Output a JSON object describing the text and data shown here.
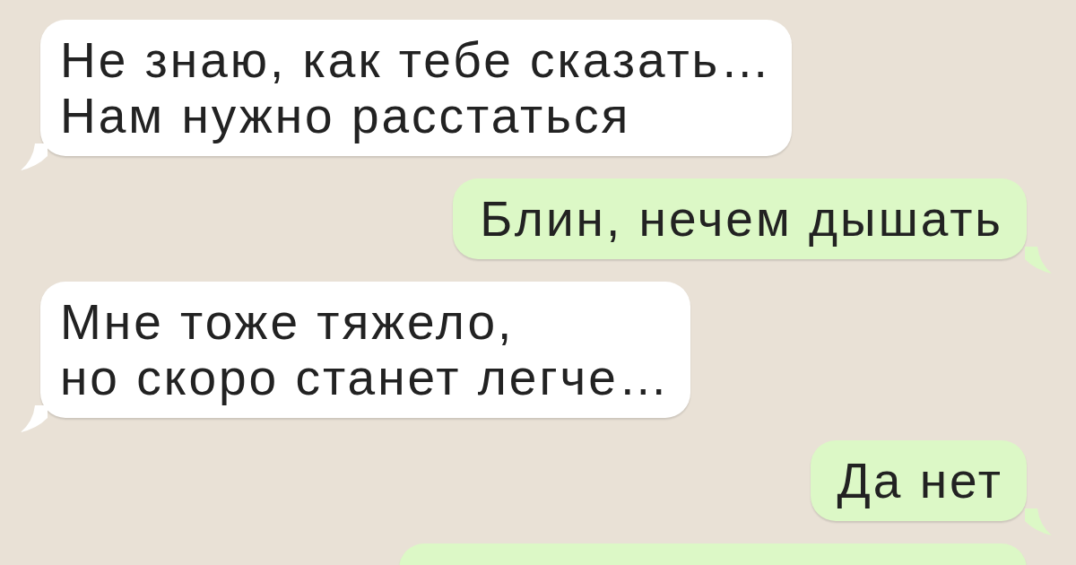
{
  "messages": [
    {
      "kind": "incoming",
      "lines": [
        "Не знаю, как тебе сказать…",
        "Нам нужно расстаться"
      ]
    },
    {
      "kind": "outgoing",
      "lines": [
        "Блин, нечем дышать"
      ]
    },
    {
      "kind": "incoming",
      "lines": [
        "Мне тоже тяжело,",
        "но скоро станет легче…"
      ]
    },
    {
      "kind": "outgoing",
      "lines": [
        "Да нет"
      ]
    },
    {
      "kind": "outgoing"
    }
  ]
}
